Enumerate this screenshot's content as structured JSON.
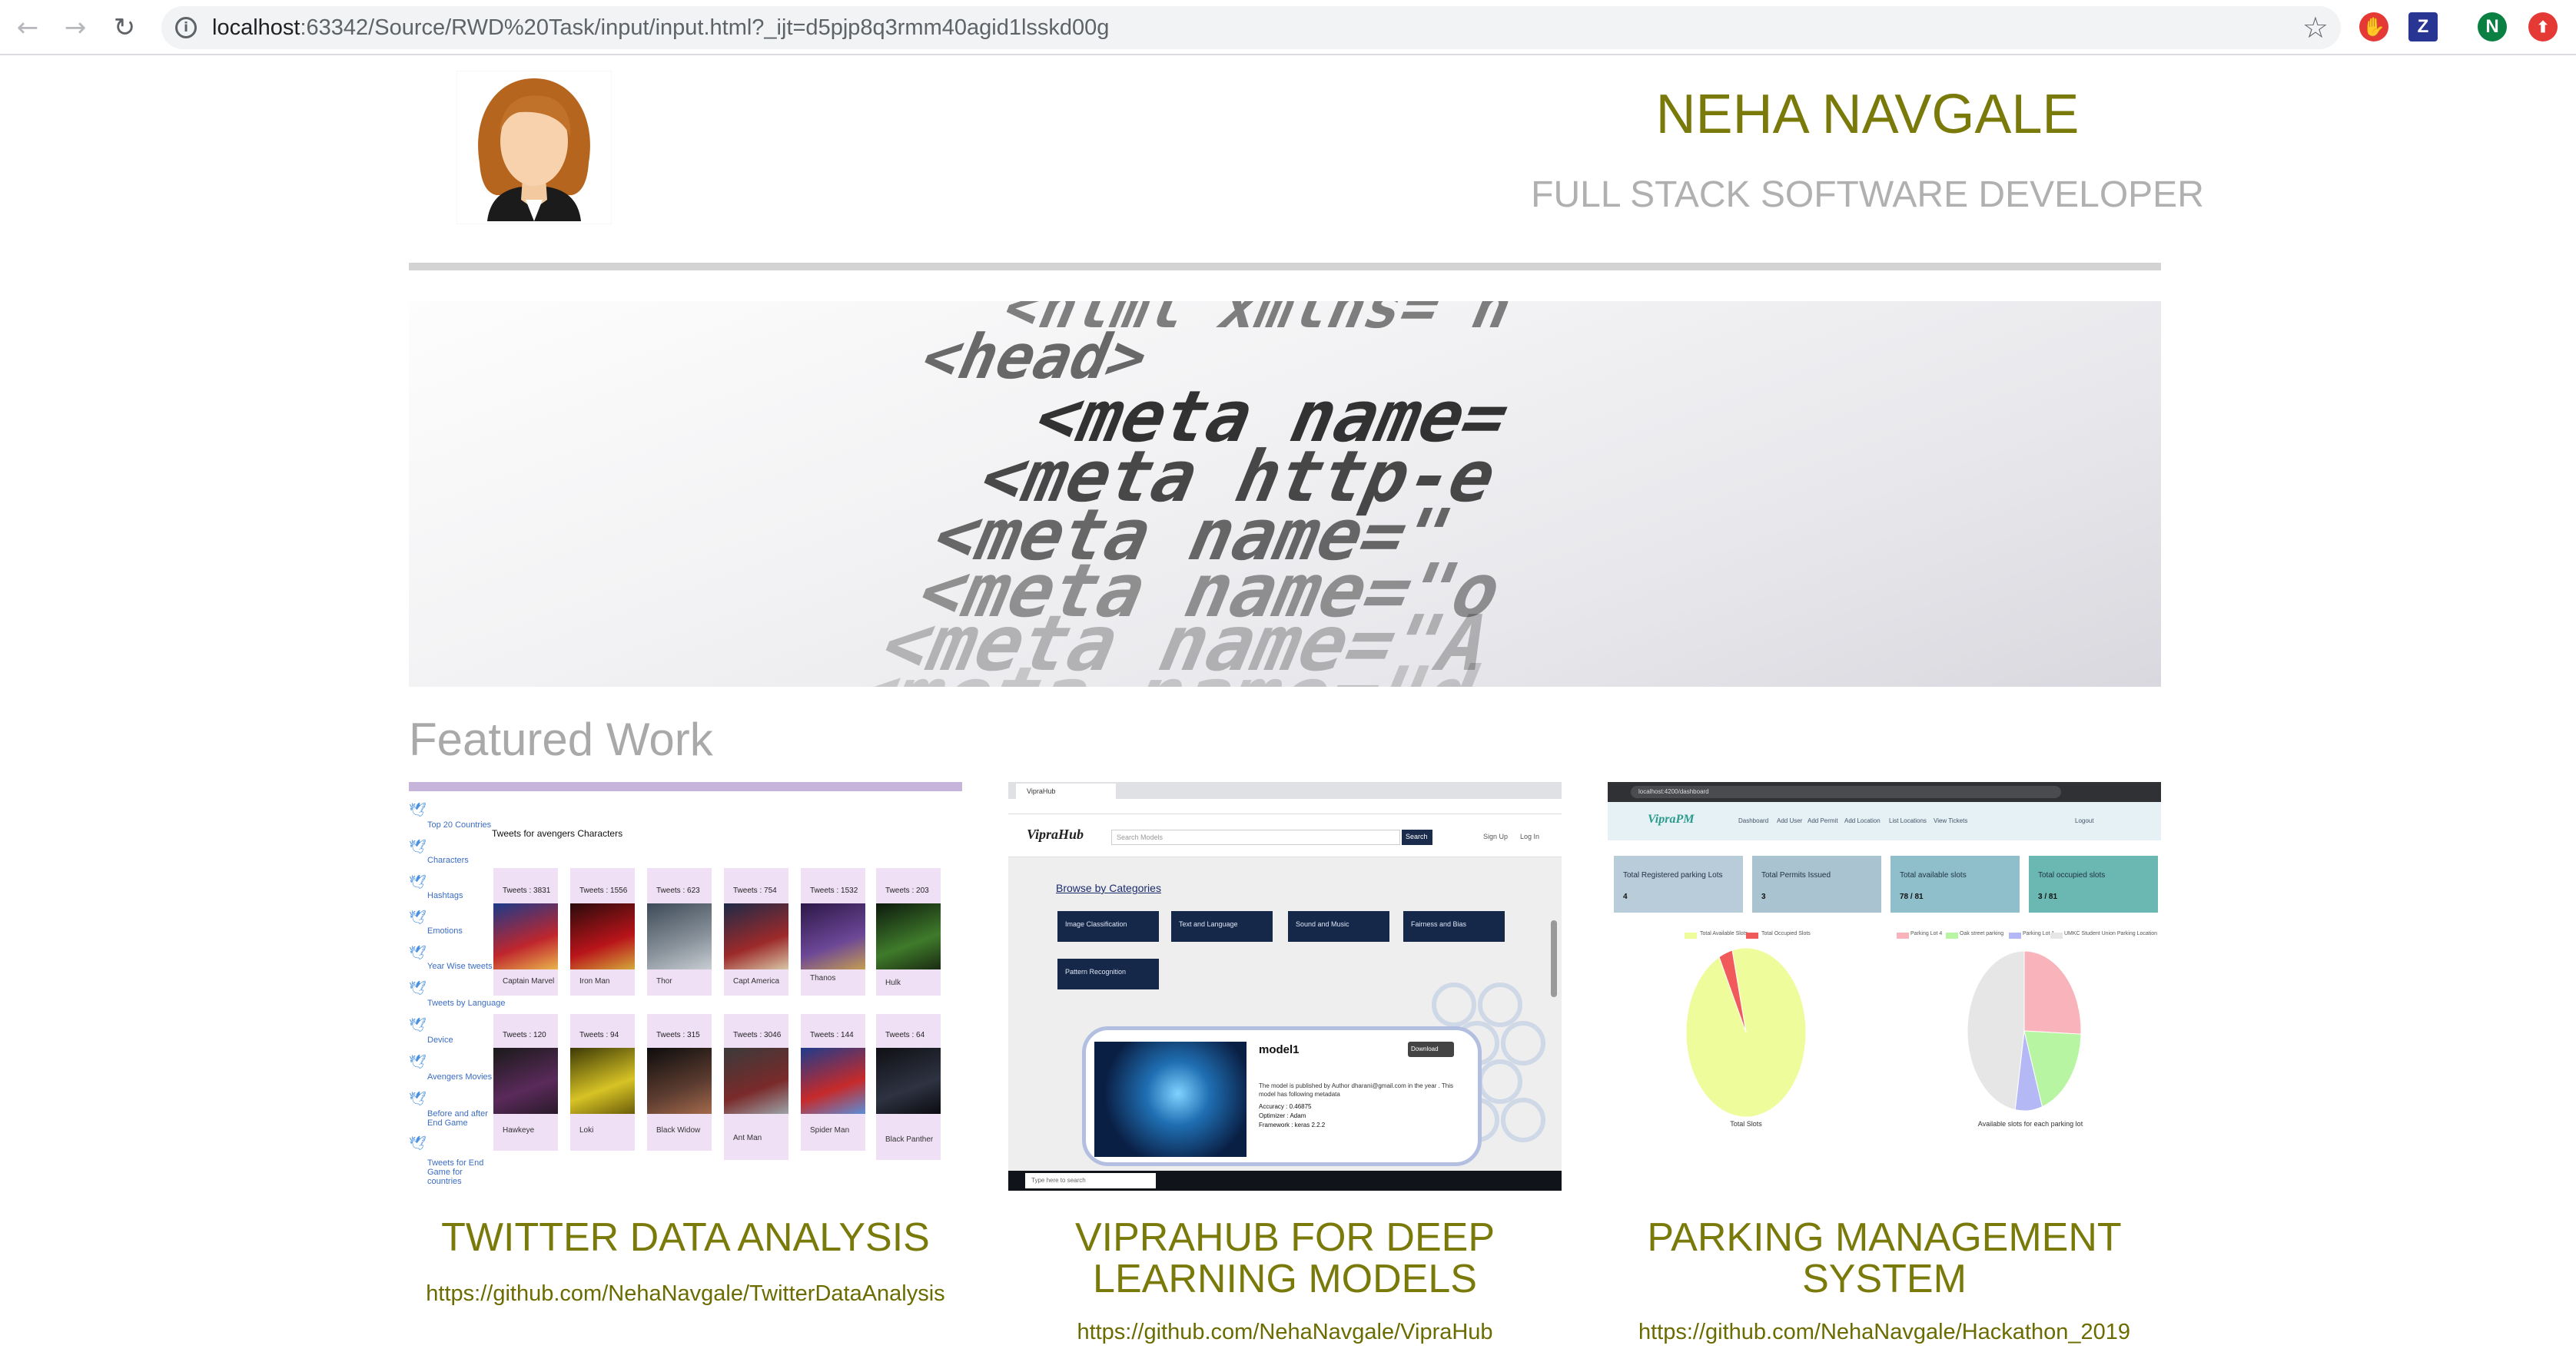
{
  "browser": {
    "url_host": "localhost",
    "url_path": ":63342/Source/RWD%20Task/input/input.html?_ijt=d5pjp8q3rmm40agid1lsskd00g",
    "profile_initial": "N",
    "extension_z": "Z",
    "icons": [
      "back-arrow-icon",
      "forward-arrow-icon",
      "reload-icon",
      "info-icon",
      "star-icon",
      "adblock-icon",
      "zotero-icon",
      "profile-avatar-icon",
      "update-icon"
    ],
    "colors": {
      "accent_red": "#e53935",
      "profile_green": "#0b8043"
    }
  },
  "header": {
    "name": "NEHA NAVGALE",
    "role": "FULL STACK SOFTWARE DEVELOPER",
    "name_color": "#7a7a0a",
    "role_color": "#b0b0b0"
  },
  "banner": {
    "code_lines": [
      "<html   xmlns=\"h",
      "<head>",
      "<meta   name=",
      "<meta   http-e",
      "<meta   name=\"",
      "<meta   name=\"o",
      "<meta   name=\"A",
      "<meta   name=\"d"
    ]
  },
  "featured": {
    "title": "Featured Work",
    "cards": [
      {
        "title": "TWITTER DATA ANALYSIS",
        "link": "https://github.com/NehaNavgale/TwitterDataAnalysis",
        "screenshot": {
          "heading": "Tweets for avengers Characters",
          "sidebar": [
            "Top 20 Countries",
            "Characters",
            "Hashtags",
            "Emotions",
            "Year Wise tweets",
            "Tweets by Language",
            "Device",
            "Avengers Movies",
            "Before and after End Game",
            "Tweets for End Game for countries"
          ],
          "row1": [
            {
              "count": "Tweets : 3831",
              "name": "Captain Marvel"
            },
            {
              "count": "Tweets : 1556",
              "name": "Iron Man"
            },
            {
              "count": "Tweets : 623",
              "name": "Thor"
            },
            {
              "count": "Tweets : 754",
              "name": "Capt America"
            },
            {
              "count": "Tweets : 1532",
              "name": "Thanos"
            },
            {
              "count": "Tweets : 203",
              "name": "Hulk"
            }
          ],
          "row2": [
            {
              "count": "Tweets : 120",
              "name": "Hawkeye"
            },
            {
              "count": "Tweets : 94",
              "name": "Loki"
            },
            {
              "count": "Tweets : 315",
              "name": "Black Widow"
            },
            {
              "count": "Tweets : 3046",
              "name": "Ant Man"
            },
            {
              "count": "Tweets : 144",
              "name": "Spider Man"
            },
            {
              "count": "Tweets : 64",
              "name": "Black Panther"
            }
          ]
        }
      },
      {
        "title": "VIPRAHUB FOR DEEP LEARNING MODELS",
        "link": "https://github.com/NehaNavgale/VipraHub",
        "screenshot": {
          "tab": "VipraHub",
          "logo": "VipraHub",
          "search_placeholder": "Search Models",
          "search_button": "Search",
          "nav": [
            "Sign Up",
            "Log In"
          ],
          "browse": "Browse by Categories",
          "categories": [
            "Image Classification",
            "Text and Language",
            "Sound and Music",
            "Fairness and Bias",
            "Pattern Recognition"
          ],
          "model_name": "model1",
          "download": "Download",
          "model_desc": "The model is published by Author dharani@gmail.com in the year . This model has following metadata",
          "accuracy": "Accuracy : 0.46875",
          "optimizer": "Optimizer : Adam",
          "framework": "Framework : keras 2.2.2",
          "taskbar_search": "Type here to search"
        }
      },
      {
        "title": "PARKING MANAGEMENT SYSTEM",
        "link": "https://github.com/NehaNavgale/Hackathon_2019",
        "screenshot": {
          "url": "localhost:4200/dashboard",
          "logo": "VipraPM",
          "nav": [
            "Dashboard",
            "Add User",
            "Add Permit",
            "Add Location",
            "List Locations",
            "View Tickets",
            "Logout"
          ],
          "stats": [
            {
              "label": "Total Registered parking Lots",
              "value": "4",
              "color": "#b8ccd9"
            },
            {
              "label": "Total Permits Issued",
              "value": "3",
              "color": "#a9c3d1"
            },
            {
              "label": "Total available slots",
              "value": "78 / 81",
              "color": "#8fbfcb"
            },
            {
              "label": "Total occupied slots",
              "value": "3 / 81",
              "color": "#6ab8b1"
            }
          ],
          "pie1_legend": [
            "Total Available Slots",
            "Total Occupied Slots"
          ],
          "pie1_label": "Total Slots",
          "pie2_legend": [
            "Parking Lot 4",
            "Oak street parking",
            "Parking Lot 1",
            "UMKC Student Union Parking Location"
          ],
          "pie2_label": "Available slots for each parking lot"
        }
      }
    ]
  },
  "chart_data": [
    {
      "type": "pie",
      "title": "Total Slots",
      "slices": [
        {
          "name": "Total Available Slots",
          "value": 78,
          "color": "#eefc9c"
        },
        {
          "name": "Total Occupied Slots",
          "value": 3,
          "color": "#f05a5a"
        }
      ]
    },
    {
      "type": "pie",
      "title": "Available slots for each parking lot",
      "slices": [
        {
          "name": "Parking Lot 4",
          "value": 20,
          "color": "#f9b3ba"
        },
        {
          "name": "Oak street parking",
          "value": 15,
          "color": "#b8f5a3"
        },
        {
          "name": "Parking Lot 1",
          "value": 6,
          "color": "#b4b8f5"
        },
        {
          "name": "UMKC Student Union Parking Location",
          "value": 37,
          "color": "#e6e6e6"
        }
      ]
    }
  ]
}
